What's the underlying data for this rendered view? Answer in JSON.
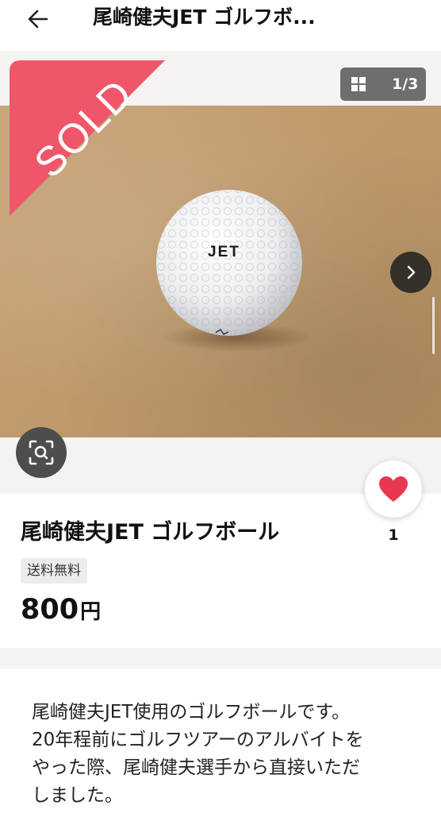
{
  "app_bar": {
    "title": "尾崎健夫JET ゴルフボ...",
    "back_icon": "arrow-back-icon"
  },
  "gallery": {
    "sold_label": "SOLD",
    "sold_color": "#f0566a",
    "counter_text": "1/3",
    "ball_text": "JET",
    "icons": {
      "grid": "grid-icon",
      "next": "chevron-right-icon",
      "lens": "image-search-icon"
    }
  },
  "item": {
    "title": "尾崎健夫JET ゴルフボール",
    "shipping_tag": "送料無料",
    "price": "800",
    "currency": "円",
    "like_count": "1",
    "like_color": "#e8384f"
  },
  "description": {
    "text": "尾崎健夫JET使用のゴルフボールです。\n20年程前にゴルフツアーのアルバイトを\nやった際、尾崎健夫選手から直接いただ\nしました。"
  }
}
